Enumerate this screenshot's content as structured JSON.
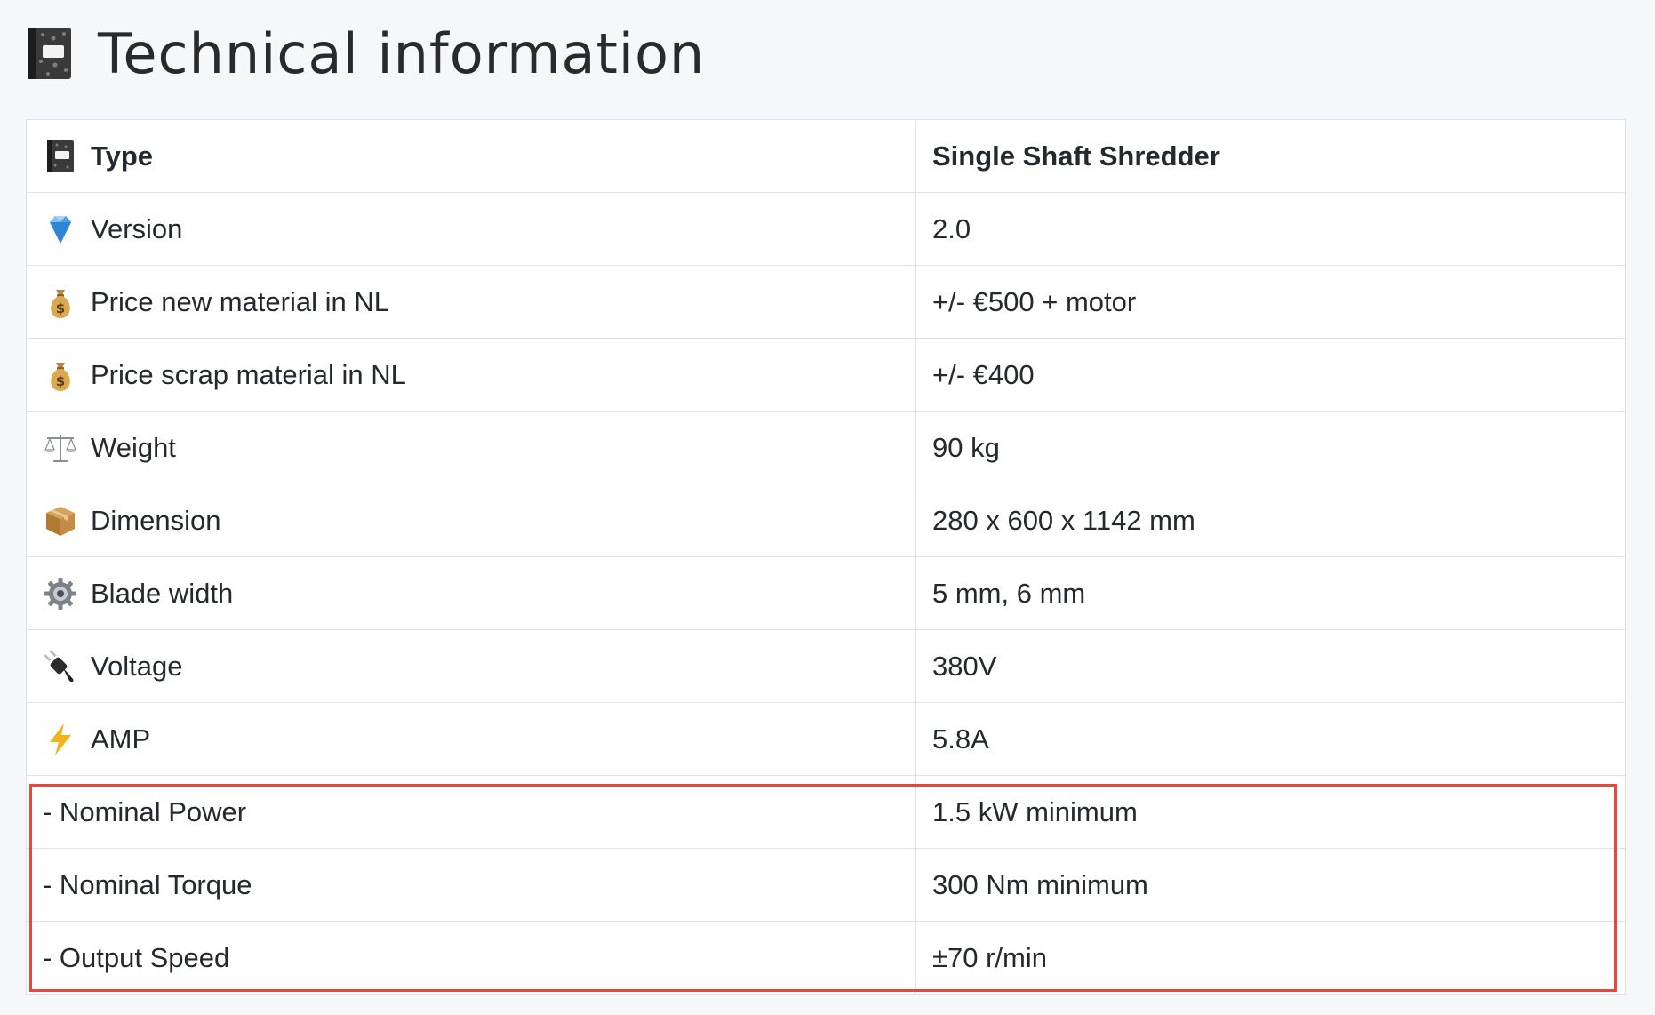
{
  "page": {
    "title": "Technical information",
    "title_icon": "notebook-icon"
  },
  "colors": {
    "background": "#f6f7f9",
    "border": "#dfe2e5",
    "highlight": "#e5483f",
    "text": "#24292e"
  },
  "rows": [
    {
      "icon": "notebook-icon",
      "label": "Type",
      "value": "Single Shaft Shredder",
      "header": true
    },
    {
      "icon": "gem-icon",
      "label": "Version",
      "value": "2.0"
    },
    {
      "icon": "money-bag-icon",
      "label": "Price new material in NL",
      "value": "+/- €500 + motor"
    },
    {
      "icon": "money-bag-icon",
      "label": "Price scrap material in NL",
      "value": "+/- €400"
    },
    {
      "icon": "scales-icon",
      "label": "Weight",
      "value": "90 kg"
    },
    {
      "icon": "package-icon",
      "label": "Dimension",
      "value": "280 x 600 x 1142 mm"
    },
    {
      "icon": "gear-icon",
      "label": "Blade width",
      "value": "5 mm, 6 mm"
    },
    {
      "icon": "plug-icon",
      "label": "Voltage",
      "value": "380V"
    },
    {
      "icon": "lightning-icon",
      "label": "AMP",
      "value": "5.8A"
    },
    {
      "icon": "",
      "label": "- Nominal Power",
      "value": "1.5 kW minimum"
    },
    {
      "icon": "",
      "label": "- Nominal Torque",
      "value": "300 Nm minimum"
    },
    {
      "icon": "",
      "label": "- Output Speed",
      "value": "±70 r/min"
    }
  ]
}
